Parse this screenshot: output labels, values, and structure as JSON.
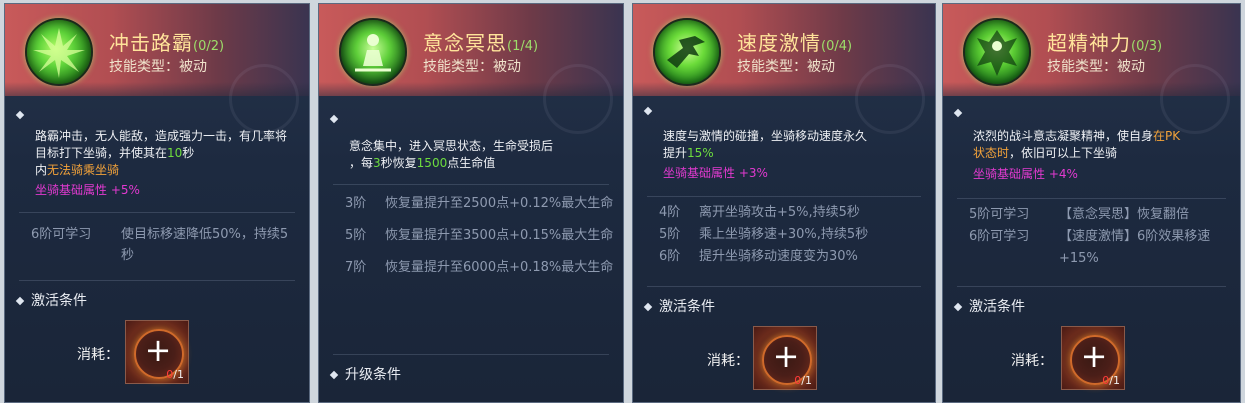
{
  "panels": [
    {
      "title": "冲击路霸",
      "count": "(0/2)",
      "type": "技能类型：被动",
      "desc": [
        {
          "t": "路霸冲击，无人能敌，造成强力一击，"
        },
        {
          "t": "有几率将目标打下坐骑，并使其在"
        },
        {
          "t": "10",
          "c": "green"
        },
        {
          "t": "秒"
        },
        {
          "br": true
        },
        {
          "t": "内"
        },
        {
          "t": "无法骑乘坐骑",
          "c": "orange"
        }
      ],
      "attr_label": "坐骑基础属性 +5%",
      "tiers": [
        {
          "level": "6阶可学习",
          "text": "使目标移速降低50%，持续5秒"
        }
      ],
      "activation_title": "激活条件",
      "consume_label": "消耗：",
      "slot_have": "0",
      "slot_need": "/1"
    },
    {
      "title": "意念冥思",
      "count": "(1/4)",
      "type": "技能类型：被动",
      "desc": [
        {
          "t": "意念集中，进入冥思状态，生命受损后"
        },
        {
          "br": true
        },
        {
          "t": "，每"
        },
        {
          "t": "3",
          "c": "green"
        },
        {
          "t": "秒恢复"
        },
        {
          "t": "1500",
          "c": "green"
        },
        {
          "t": "点生命值"
        }
      ],
      "tiers": [
        {
          "level": "3阶",
          "text": "恢复量提升至2500点+0.12%最大生命"
        },
        {
          "level": "5阶",
          "text": "恢复量提升至3500点+0.15%最大生命"
        },
        {
          "level": "7阶",
          "text": "恢复量提升至6000点+0.18%最大生命"
        }
      ],
      "upgrade_title": "升级条件"
    },
    {
      "title": "速度激情",
      "count": "(0/4)",
      "type": "技能类型：被动",
      "desc": [
        {
          "t": "速度与激情的碰撞，坐骑移动速度永久"
        },
        {
          "br": true
        },
        {
          "t": "提升"
        },
        {
          "t": "15%",
          "c": "green"
        }
      ],
      "attr_label": "坐骑基础属性 +3%",
      "tiers": [
        {
          "level": "4阶",
          "text": "离开坐骑攻击+5%,持续5秒"
        },
        {
          "level": "5阶",
          "text": "乘上坐骑移速+30%,持续5秒"
        },
        {
          "level": "6阶",
          "text": "提升坐骑移动速度变为30%"
        }
      ],
      "activation_title": "激活条件",
      "consume_label": "消耗：",
      "slot_have": "0",
      "slot_need": "/1"
    },
    {
      "title": "超精神力",
      "count": "(0/3)",
      "type": "技能类型：被动",
      "desc": [
        {
          "t": "浓烈的战斗意志凝聚精神，使自身"
        },
        {
          "t": "在PK",
          "c": "orange"
        },
        {
          "br": true
        },
        {
          "t": "状态时",
          "c": "orange"
        },
        {
          "t": "，依旧可以上下坐骑"
        }
      ],
      "attr_label": "坐骑基础属性 +4%",
      "tiers": [
        {
          "level": "5阶可学习",
          "text": "【意念冥思】恢复翻倍"
        },
        {
          "level": "6阶可学习",
          "text": "【速度激情】6阶效果移速+15%"
        }
      ],
      "activation_title": "激活条件",
      "consume_label": "消耗：",
      "slot_have": "0",
      "slot_need": "/1"
    }
  ],
  "colors": {
    "title": "#ffe39a",
    "count": "#9dde6a",
    "highlight_green": "#6ddc3e",
    "highlight_orange": "#f2a23a",
    "attribute": "#e23ad0",
    "tier_text": "#8e9ab0",
    "header_red": "#c85a5a"
  },
  "icons": [
    "green-burst-icon",
    "meditation-icon",
    "speed-runner-icon",
    "spirit-power-icon"
  ]
}
